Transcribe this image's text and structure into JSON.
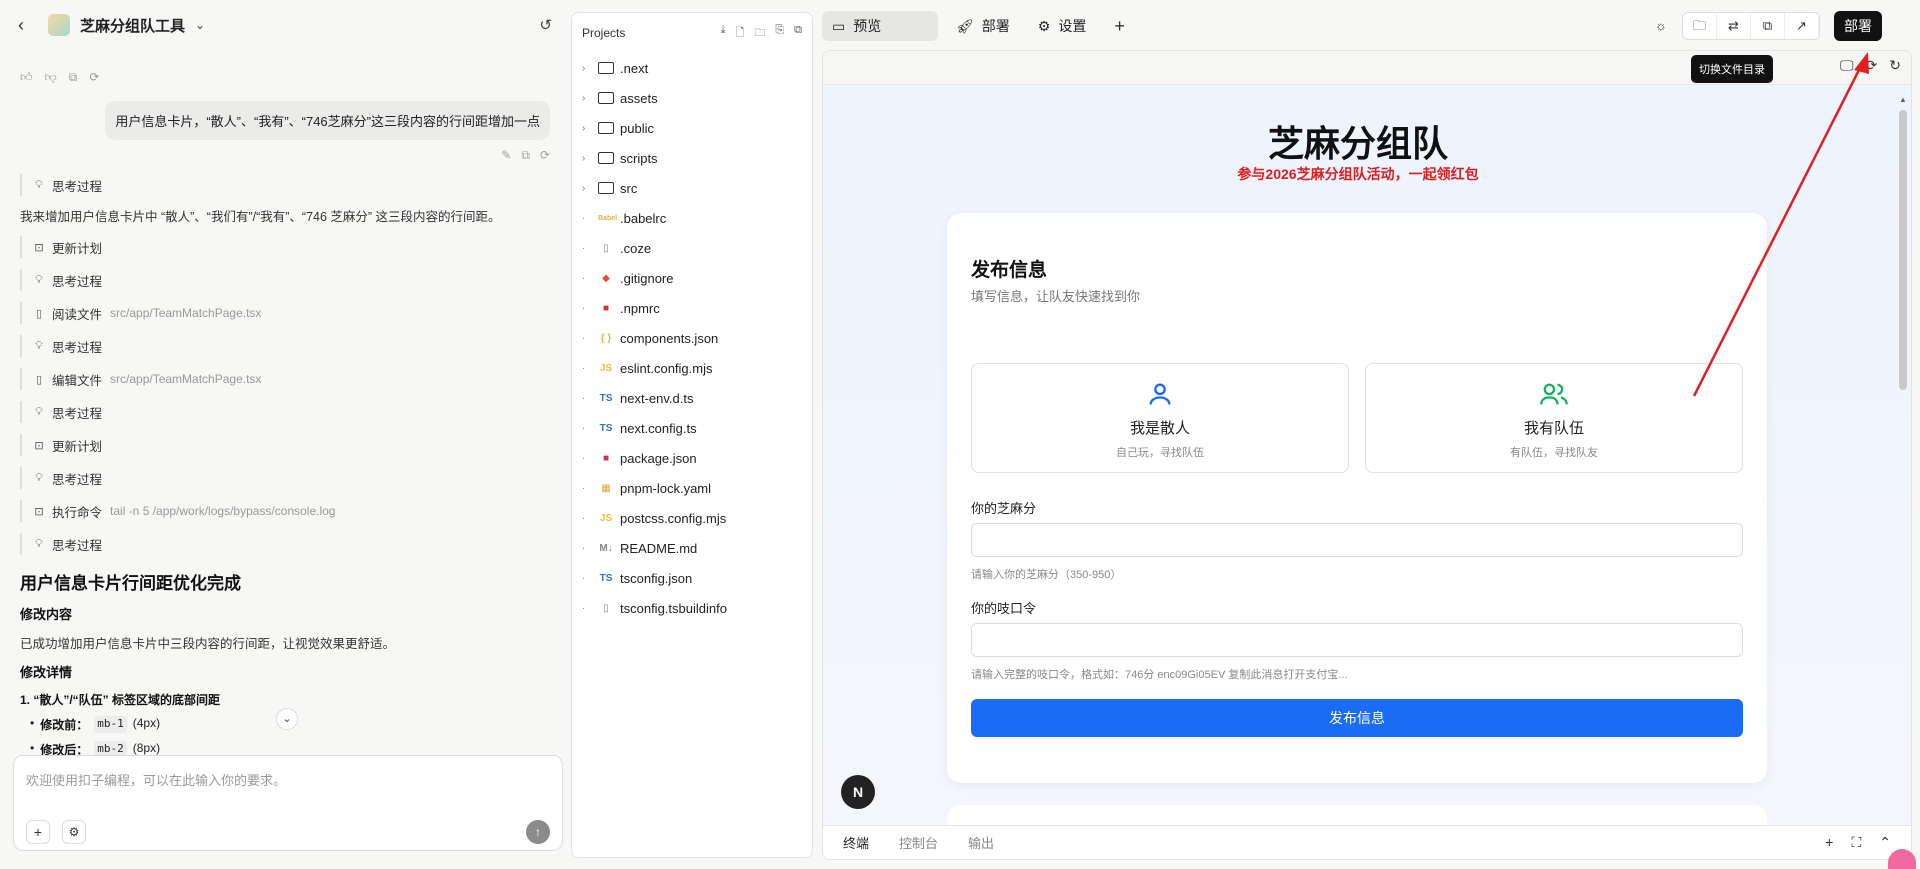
{
  "chat": {
    "title": "芝麻分组队工具",
    "user_message": "用户信息卡片，“散人”、“我有”、“746芝麻分”这三段内容的行间距增加一点",
    "steps": [
      {
        "icon": "bulb",
        "label": "思考过程",
        "sub": ""
      },
      {
        "type": "text",
        "label": "我来增加用户信息卡片中 “散人”、“我们有”/“我有”、“746 芝麻分” 这三段内容的行间距。"
      },
      {
        "icon": "plan",
        "label": "更新计划",
        "sub": ""
      },
      {
        "icon": "bulb",
        "label": "思考过程",
        "sub": ""
      },
      {
        "icon": "file",
        "label": "阅读文件",
        "sub": "src/app/TeamMatchPage.tsx"
      },
      {
        "icon": "bulb",
        "label": "思考过程",
        "sub": ""
      },
      {
        "icon": "file",
        "label": "编辑文件",
        "sub": "src/app/TeamMatchPage.tsx"
      },
      {
        "icon": "bulb",
        "label": "思考过程",
        "sub": ""
      },
      {
        "icon": "plan",
        "label": "更新计划",
        "sub": ""
      },
      {
        "icon": "bulb",
        "label": "思考过程",
        "sub": ""
      },
      {
        "icon": "plan",
        "label": "执行命令",
        "sub": "tail -n 5 /app/work/logs/bypass/console.log"
      },
      {
        "icon": "bulb",
        "label": "思考过程",
        "sub": ""
      }
    ],
    "result_title": "用户信息卡片行间距优化完成",
    "section1": "修改内容",
    "section1_text": "已成功增加用户信息卡片中三段内容的行间距，让视觉效果更舒适。",
    "section2": "修改详情",
    "detail_heading": "1. “散人”/“队伍” 标签区域的底部间距",
    "before_label": "修改前：",
    "before_code": "mb-1",
    "before_val": "(4px)",
    "after_label": "修改后：",
    "after_code": "mb-2",
    "after_val": "(8px)",
    "composer_placeholder": "欢迎使用扣子编程，可以在此输入你的要求。"
  },
  "tree": {
    "header": "Projects",
    "items": [
      {
        "name": ".next",
        "kind": "folder"
      },
      {
        "name": "assets",
        "kind": "folder"
      },
      {
        "name": "public",
        "kind": "folder"
      },
      {
        "name": "scripts",
        "kind": "folder"
      },
      {
        "name": "src",
        "kind": "folder"
      },
      {
        "name": ".babelrc",
        "kind": "babel",
        "icon": "Babel",
        "color": "#d9b44a"
      },
      {
        "name": ".coze",
        "kind": "file",
        "icon": "▯",
        "color": "#888888"
      },
      {
        "name": ".gitignore",
        "kind": "git",
        "icon": "◆",
        "color": "#e24c32"
      },
      {
        "name": ".npmrc",
        "kind": "npm",
        "icon": "■",
        "color": "#cb3837"
      },
      {
        "name": "components.json",
        "kind": "json",
        "icon": "{ }",
        "color": "#d9b44a"
      },
      {
        "name": "eslint.config.mjs",
        "kind": "js",
        "icon": "JS",
        "color": "#e8c23a"
      },
      {
        "name": "next-env.d.ts",
        "kind": "ts",
        "icon": "TS",
        "color": "#2f74c0"
      },
      {
        "name": "next.config.ts",
        "kind": "ts",
        "icon": "TS",
        "color": "#2f74c0"
      },
      {
        "name": "package.json",
        "kind": "npm",
        "icon": "■",
        "color": "#cb3837"
      },
      {
        "name": "pnpm-lock.yaml",
        "kind": "pnpm",
        "icon": "▦",
        "color": "#e8a33a"
      },
      {
        "name": "postcss.config.mjs",
        "kind": "js",
        "icon": "JS",
        "color": "#e8c23a"
      },
      {
        "name": "README.md",
        "kind": "md",
        "icon": "M↓",
        "color": "#888888"
      },
      {
        "name": "tsconfig.json",
        "kind": "ts",
        "icon": "TS",
        "color": "#2f74c0"
      },
      {
        "name": "tsconfig.tsbuildinfo",
        "kind": "file",
        "icon": "▯",
        "color": "#888888"
      }
    ]
  },
  "tabs": {
    "preview": "预览",
    "deploy": "部署",
    "settings": "设置"
  },
  "deploy_button": "部署",
  "tooltip": "切换文件目录",
  "site": {
    "title": "芝麻分组队",
    "subtitle": "参与2026芝麻分组队活动，一起领红包",
    "card_title": "发布信息",
    "card_desc": "填写信息，让队友快速找到你",
    "solo_name": "我是散人",
    "solo_desc": "自己玩，寻找队伍",
    "team_name": "我有队伍",
    "team_desc": "有队伍，寻找队友",
    "score_label": "你的芝麻分",
    "score_hint": "请输入你的芝麻分（350-950）",
    "code_label": "你的吱口令",
    "code_hint": "请输入完整的吱口令，格式如：746分 enc09Gi05EV 复制此消息打开支付宝...",
    "publish": "发布信息",
    "badge": "N"
  },
  "bottom_tabs": [
    "终端",
    "控制台",
    "输出"
  ],
  "colors": {
    "accent_blue": "#1b6cf5",
    "subtitle_red": "#e21b1b",
    "arrow_red": "#e02020"
  }
}
